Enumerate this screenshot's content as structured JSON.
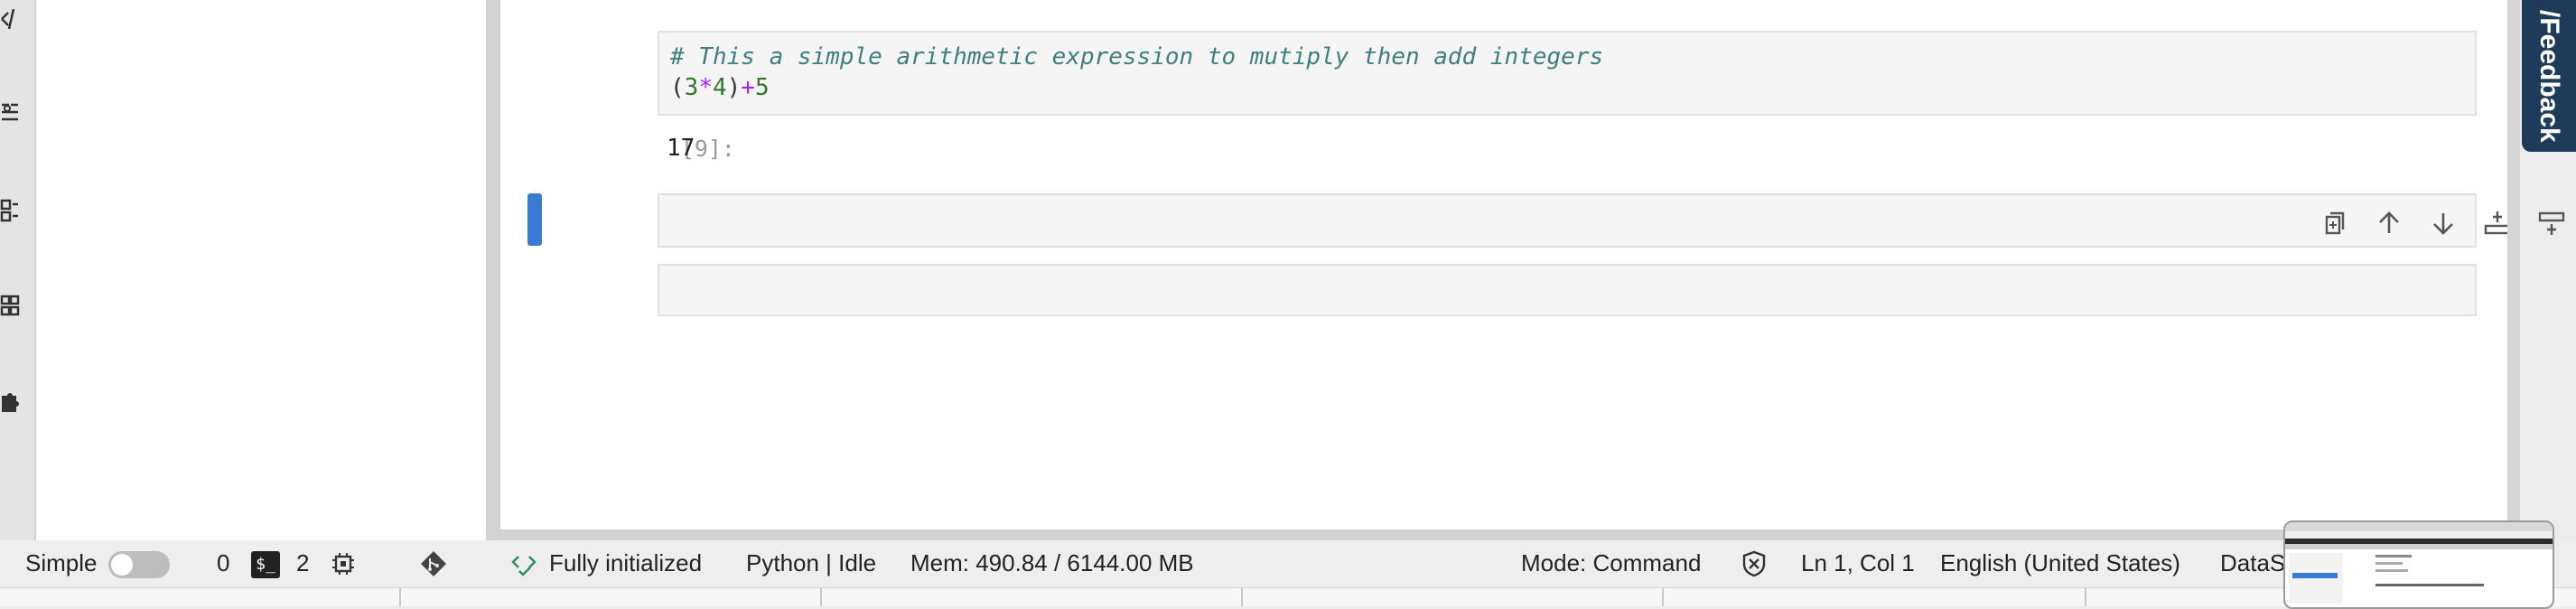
{
  "sidebar": {
    "icons": [
      "code-icon",
      "property-inspector-icon",
      "table-of-contents-icon",
      "extension-grid-icon",
      "puzzle-icon"
    ]
  },
  "feedback": {
    "label": "/Feedback"
  },
  "notebook": {
    "cells": [
      {
        "prompt": "[9]:",
        "code_comment": "# This a simple arithmetic expression to mutiply then add integers",
        "code_tokens": [
          "(",
          "3",
          "*",
          "4",
          ")",
          "+",
          "5"
        ],
        "output_prompt": "[9]:",
        "output": "17"
      },
      {
        "prompt": "[ ]:",
        "active": true
      },
      {
        "prompt": "[ ]:"
      }
    ],
    "cell_toolbar": [
      "duplicate-icon",
      "move-up-icon",
      "move-down-icon",
      "insert-below-icon",
      "insert-above-icon",
      "delete-icon"
    ]
  },
  "statusbar": {
    "simple_label": "Simple",
    "simple_mode_on": false,
    "kernel_count": "0",
    "terminal_icon": "$_",
    "terminal_count": "2",
    "init_status": "Fully initialized",
    "kernel_status": "Python | Idle",
    "memory": "Mem: 490.84 / 6144.00 MB",
    "mode": "Mode: Command",
    "cursor_position": "Ln 1, Col 1",
    "language": "English (United States)",
    "extra": "DataS"
  }
}
